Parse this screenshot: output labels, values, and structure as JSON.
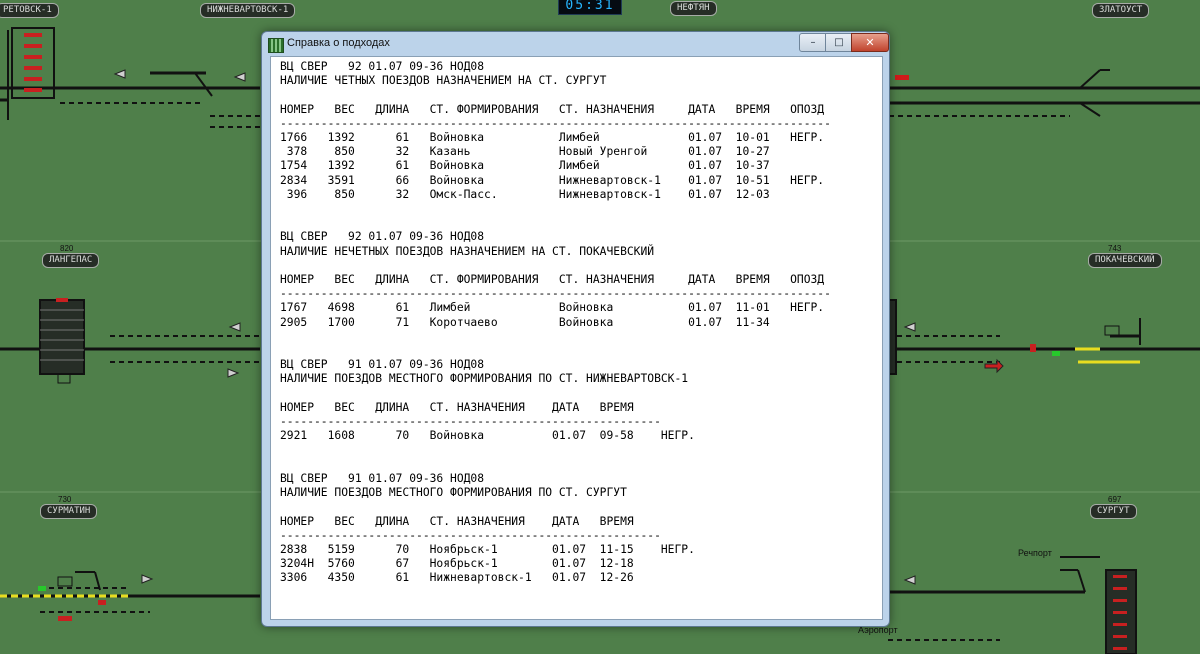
{
  "clock": "05:31",
  "stations": {
    "top_left": "РЕТОВСК-1",
    "top_center": "НИЖНЕВАРТОВСК-1",
    "top_neftyan": "НЕФТЯН",
    "top_right": "ЗЛАТОУСТ",
    "mid_left_num": "820",
    "mid_left": "ЛАНГЕПАС",
    "mid_right_num": "743",
    "mid_right": "ПОКАЧЕВСКИЙ",
    "bot_left_num": "730",
    "bot_left": "СУРМАТИН",
    "bot_right_num": "697",
    "bot_right": "СУРГУТ"
  },
  "map_labels": {
    "bot_right_rechport": "Речпорт",
    "bot_right_aeroport": "Аэропорт"
  },
  "window": {
    "title": "Справка о подходах",
    "min_glyph": "–",
    "max_glyph": "□",
    "close_glyph": "✕"
  },
  "report_lines": [
    "ВЦ СВЕР   92 01.07 09-36 НОД08",
    "НАЛИЧИЕ ЧЕТНЫХ ПОЕЗДОВ НАЗНАЧЕНИЕМ НА СТ. СУРГУТ",
    "",
    "НОМЕР   ВЕС   ДЛИНА   СТ. ФОРМИРОВАНИЯ   СТ. НАЗНАЧЕНИЯ     ДАТА   ВРЕМЯ   ОПОЗД",
    "---------------------------------------------------------------------------------",
    "1766   1392      61   Войновка           Лимбей             01.07  10-01   НЕГР.",
    " 378    850      32   Казань             Новый Уренгой      01.07  10-27",
    "1754   1392      61   Войновка           Лимбей             01.07  10-37",
    "2834   3591      66   Войновка           Нижневартовск-1    01.07  10-51   НЕГР.",
    " 396    850      32   Омск-Пасс.         Нижневартовск-1    01.07  12-03",
    "",
    "",
    "ВЦ СВЕР   92 01.07 09-36 НОД08",
    "НАЛИЧИЕ НЕЧЕТНЫХ ПОЕЗДОВ НАЗНАЧЕНИЕМ НА СТ. ПОКАЧЕВСКИЙ",
    "",
    "НОМЕР   ВЕС   ДЛИНА   СТ. ФОРМИРОВАНИЯ   СТ. НАЗНАЧЕНИЯ     ДАТА   ВРЕМЯ   ОПОЗД",
    "---------------------------------------------------------------------------------",
    "1767   4698      61   Лимбей             Войновка           01.07  11-01   НЕГР.",
    "2905   1700      71   Коротчаево         Войновка           01.07  11-34",
    "",
    "",
    "ВЦ СВЕР   91 01.07 09-36 НОД08",
    "НАЛИЧИЕ ПОЕЗДОВ МЕСТНОГО ФОРМИРОВАНИЯ ПО СТ. НИЖНЕВАРТОВСК-1",
    "",
    "НОМЕР   ВЕС   ДЛИНА   СТ. НАЗНАЧЕНИЯ    ДАТА   ВРЕМЯ",
    "--------------------------------------------------------",
    "2921   1608      70   Войновка          01.07  09-58    НЕГР.",
    "",
    "",
    "ВЦ СВЕР   91 01.07 09-36 НОД08",
    "НАЛИЧИЕ ПОЕЗДОВ МЕСТНОГО ФОРМИРОВАНИЯ ПО СТ. СУРГУТ",
    "",
    "НОМЕР   ВЕС   ДЛИНА   СТ. НАЗНАЧЕНИЯ    ДАТА   ВРЕМЯ",
    "--------------------------------------------------------",
    "2838   5159      70   Ноябрьск-1        01.07  11-15    НЕГР.",
    "3204Н  5760      67   Ноябрьск-1        01.07  12-18",
    "3306   4350      61   Нижневартовск-1   01.07  12-26"
  ]
}
